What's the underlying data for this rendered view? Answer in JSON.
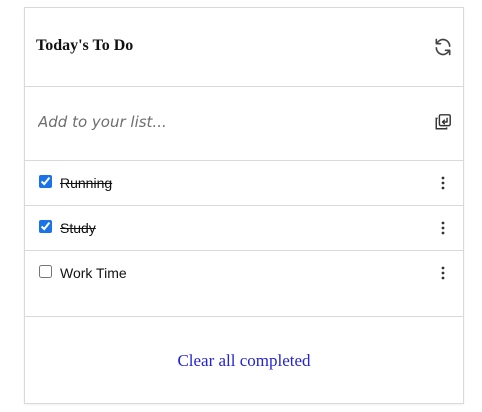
{
  "header": {
    "title": "Today's To Do",
    "refresh_icon": "refresh-icon"
  },
  "add": {
    "placeholder": "Add to your list...",
    "value": "",
    "add_icon": "add-to-list-icon"
  },
  "todos": [
    {
      "label": "Running",
      "completed": true
    },
    {
      "label": "Study",
      "completed": true
    },
    {
      "label": "Work Time",
      "completed": false
    }
  ],
  "item_menu_icon": "more-vertical-icon",
  "footer": {
    "clear_label": "Clear all completed"
  },
  "colors": {
    "accent_checkbox": "#1a73e8",
    "link": "#2323d6",
    "border": "#d9d9d9"
  }
}
